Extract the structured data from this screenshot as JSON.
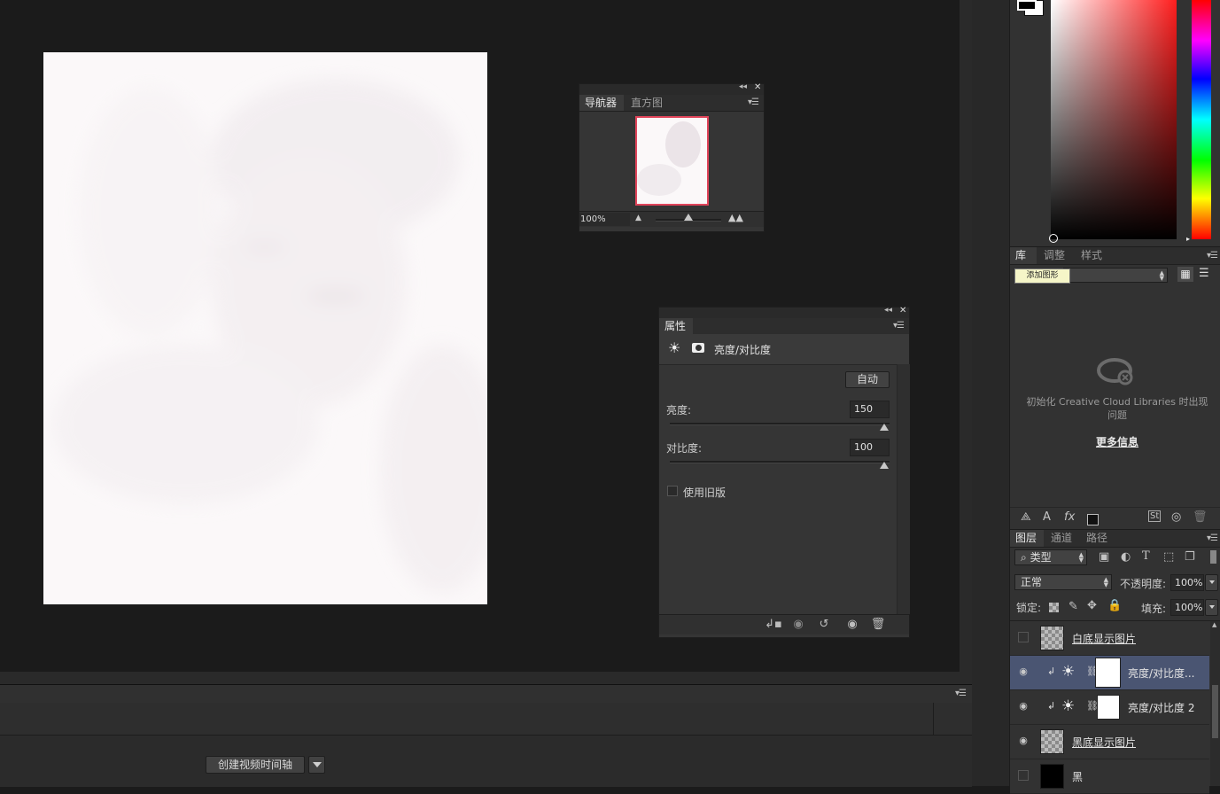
{
  "navigator": {
    "tabs": [
      "导航器",
      "直方图"
    ],
    "zoom": "100%",
    "zoom_slider_fraction": 0.5
  },
  "properties": {
    "tab": "属性",
    "adjustment_title": "亮度/对比度",
    "auto_button": "自动",
    "brightness_label": "亮度:",
    "brightness_value": "150",
    "contrast_label": "对比度:",
    "contrast_value": "100",
    "legacy_label": "使用旧版",
    "legacy_checked": false
  },
  "timeline": {
    "create_button": "创建视频时间轴"
  },
  "libraries": {
    "tabs": [
      "库",
      "调整",
      "样式"
    ],
    "tooltip": "添加图形",
    "message": "初始化 Creative Cloud Libraries 时出现问题",
    "more_info": "更多信息"
  },
  "layers": {
    "tabs": [
      "图层",
      "通道",
      "路径"
    ],
    "filter_kind": "类型",
    "blend_mode": "正常",
    "opacity_label": "不透明度:",
    "opacity": "100%",
    "lock_label": "锁定:",
    "fill_label": "填充:",
    "fill": "100%",
    "items": [
      {
        "name": "白底显示图片",
        "visible": false,
        "type": "image",
        "selected": false
      },
      {
        "name": "亮度/对比度...",
        "visible": true,
        "type": "adjustment",
        "selected": true
      },
      {
        "name": "亮度/对比度 2",
        "visible": true,
        "type": "adjustment",
        "selected": false
      },
      {
        "name": "黑底显示图片",
        "visible": true,
        "type": "image",
        "selected": false
      },
      {
        "name": "黑",
        "visible": false,
        "type": "fill",
        "selected": false
      }
    ]
  },
  "colors": {
    "canvas_bg": "#1b1b1b",
    "panel_bg": "#353535",
    "selection": "#4a5572",
    "navigator_frame": "#e0445a"
  }
}
